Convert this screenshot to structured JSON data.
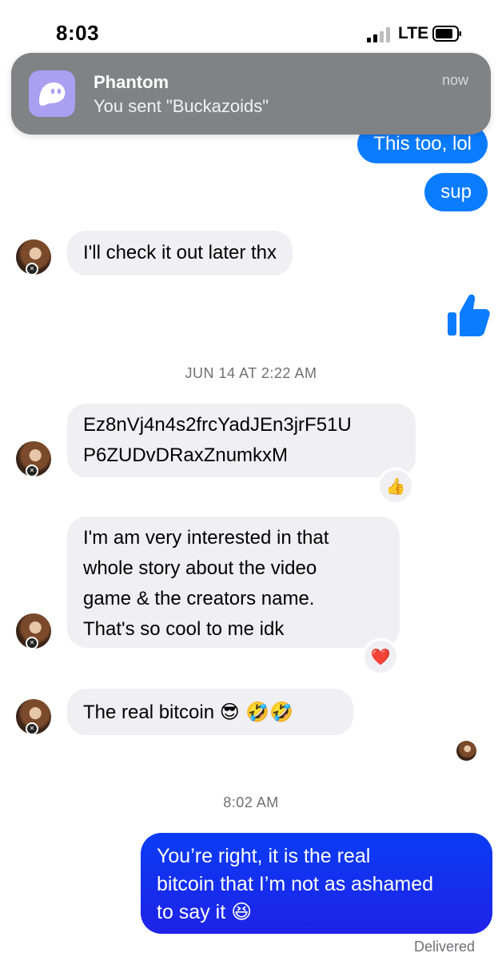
{
  "status_bar": {
    "time": "8:03",
    "network": "LTE"
  },
  "notification": {
    "app": "Phantom",
    "message": "You sent \"Buckazoids\"",
    "time": "now"
  },
  "messages": {
    "out_1": "This too, lol",
    "out_2": "sup",
    "in_1": "I'll check it out later thx",
    "timestamp_1": "JUN 14 AT 2:22 AM",
    "in_2_line1": "Ez8nVj4n4s2frcYadJEn3jrF51U",
    "in_2_line2": "P6ZUDvDRaxZnumkxM",
    "in_3_line1": "I'm am very interested in that",
    "in_3_line2": "whole story about the video",
    "in_3_line3": "game & the creators name.",
    "in_3_line4": "That's so cool to me idk",
    "in_4": "The real bitcoin",
    "in_4_emoji": "😎 🤣🤣",
    "timestamp_2": "8:02 AM",
    "out_3_line1": "You’re right, it is the real",
    "out_3_line2": "bitcoin that I’m not as ashamed",
    "out_3_line3": "to say it 😆",
    "delivered": "Delivered"
  },
  "reactions": {
    "r1": "👍",
    "r2": "❤️"
  },
  "icons": {
    "app_icon": "phantom-ghost-icon",
    "like": "thumbs-up-icon",
    "signal": "signal-icon",
    "battery": "battery-icon"
  },
  "colors": {
    "outgoing": "#0a7cff",
    "final_outgoing": "#1f22e8",
    "incoming": "#f0f0f4",
    "notification": "#808285",
    "phantom": "#ab9ff2"
  }
}
